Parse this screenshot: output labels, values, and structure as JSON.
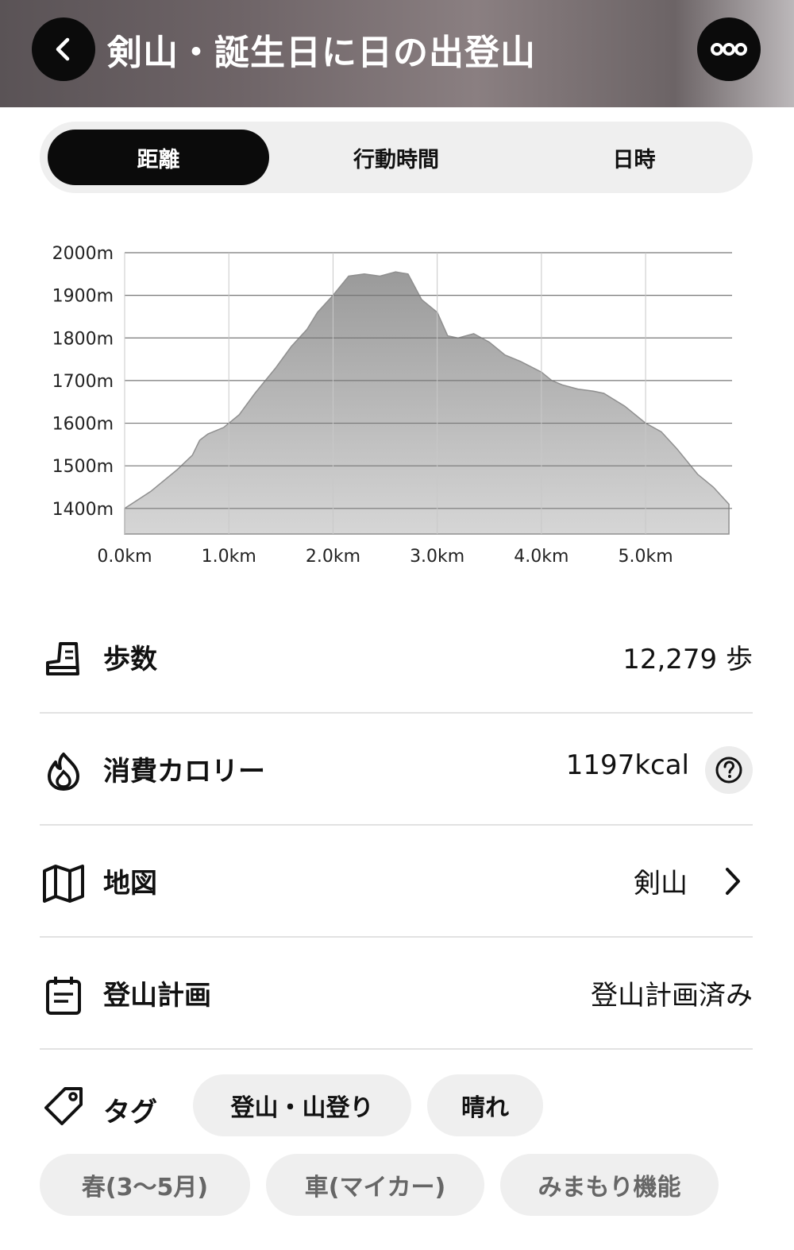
{
  "header": {
    "title": "剣山・誕生日に日の出登山",
    "back_icon": "chevron-left-icon",
    "more_icon": "more-dots-icon"
  },
  "tabs": [
    {
      "label": "距離",
      "active": true
    },
    {
      "label": "行動時間",
      "active": false
    },
    {
      "label": "日時",
      "active": false
    }
  ],
  "chart_data": {
    "type": "area",
    "title": "",
    "xlabel": "",
    "ylabel": "",
    "x_ticks": [
      "0.0km",
      "1.0km",
      "2.0km",
      "3.0km",
      "4.0km",
      "5.0km"
    ],
    "y_ticks": [
      "2000m",
      "1900m",
      "1800m",
      "1700m",
      "1600m",
      "1500m",
      "1400m"
    ],
    "xlim": [
      0,
      5.83
    ],
    "ylim": [
      1340,
      2000
    ],
    "grid": true,
    "fill_color": "#a8a8a8",
    "series": [
      {
        "x": [
          0.0,
          0.25,
          0.5,
          0.65,
          0.72,
          0.8,
          0.95,
          1.1,
          1.25,
          1.45,
          1.6,
          1.75,
          1.85,
          2.0,
          2.15,
          2.3,
          2.45,
          2.6,
          2.72,
          2.85,
          3.0,
          3.1,
          3.2,
          3.35,
          3.5,
          3.65,
          3.8,
          4.0,
          4.1,
          4.2,
          4.35,
          4.5,
          4.6,
          4.8,
          5.0,
          5.15,
          5.3,
          5.5,
          5.65,
          5.8
        ],
        "y": [
          1400,
          1440,
          1490,
          1525,
          1560,
          1575,
          1590,
          1620,
          1670,
          1730,
          1780,
          1820,
          1860,
          1900,
          1945,
          1950,
          1945,
          1955,
          1950,
          1890,
          1860,
          1805,
          1800,
          1810,
          1790,
          1760,
          1745,
          1720,
          1700,
          1690,
          1680,
          1675,
          1670,
          1640,
          1600,
          1580,
          1540,
          1480,
          1450,
          1410
        ]
      }
    ]
  },
  "stats": {
    "steps": {
      "label": "歩数",
      "value": "12,279 歩",
      "icon": "boot-icon"
    },
    "calories": {
      "label": "消費カロリー",
      "value": "1197kcal",
      "icon": "flame-icon",
      "help_icon": "question-circle-icon"
    },
    "map": {
      "label": "地図",
      "value": "剣山",
      "icon": "map-icon",
      "chevron_icon": "chevron-right-icon"
    },
    "plan": {
      "label": "登山計画",
      "value": "登山計画済み",
      "icon": "calendar-icon"
    }
  },
  "tags": {
    "label": "タグ",
    "icon": "tag-icon",
    "active": [
      "登山・山登り",
      "晴れ"
    ],
    "inactive": [
      "春(3～5月)",
      "車(マイカー)",
      "みまもり機能"
    ]
  }
}
